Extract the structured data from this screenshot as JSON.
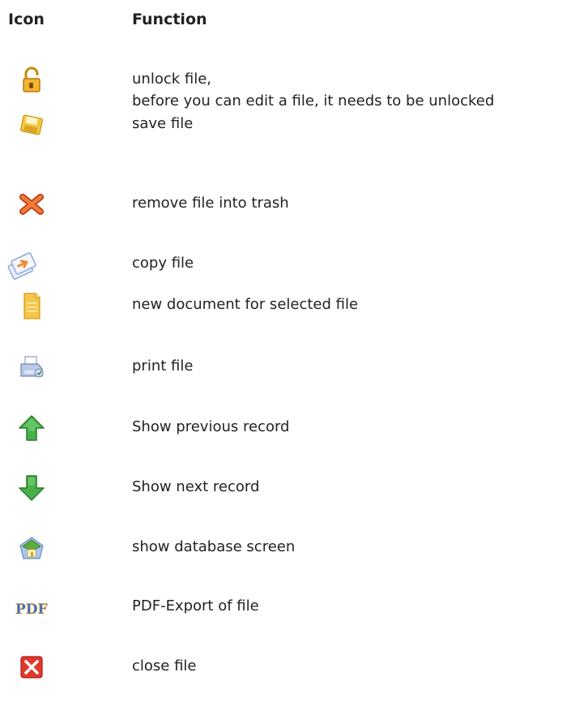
{
  "header": {
    "icon_col": "Icon",
    "function_col": "Function"
  },
  "rows": [
    {
      "icon": "unlock-icon",
      "text": "unlock file,",
      "text2": "before you can edit a file, it needs to be unlocked"
    },
    {
      "icon": "save-icon",
      "text": "save file"
    },
    {
      "icon": "delete-icon",
      "text": "remove file into trash"
    },
    {
      "icon": "copy-icon",
      "text": "copy file"
    },
    {
      "icon": "new-document-icon",
      "text": "new document for selected file"
    },
    {
      "icon": "print-icon",
      "text": "print file"
    },
    {
      "icon": "arrow-up-icon",
      "text": "Show previous record"
    },
    {
      "icon": "arrow-down-icon",
      "text": "Show next record"
    },
    {
      "icon": "home-icon",
      "text": "show database screen"
    },
    {
      "icon": "pdf-icon",
      "text": "PDF-Export of file"
    },
    {
      "icon": "close-icon",
      "text": "close file"
    }
  ],
  "colors": {
    "gold": "#f0b323",
    "orange_x": "#e8561c",
    "green": "#3aa53a",
    "red_close": "#d9291c"
  }
}
